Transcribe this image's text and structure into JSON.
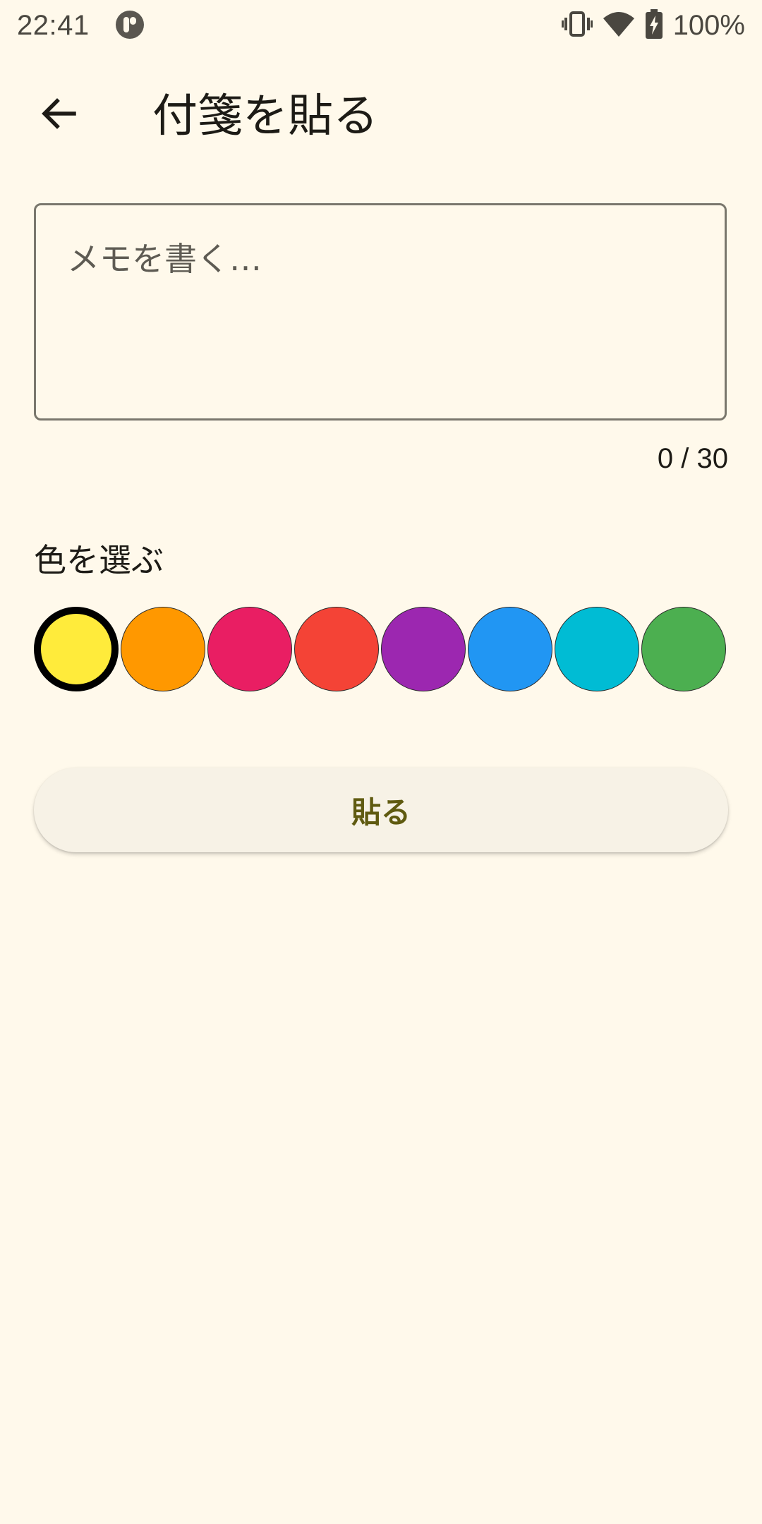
{
  "status_bar": {
    "time": "22:41",
    "app_icon": "pip-app-icon",
    "icons": [
      "vibrate-icon",
      "wifi-icon",
      "battery-charging-icon"
    ],
    "battery": "100%"
  },
  "app_bar": {
    "back_icon": "arrow-left-icon",
    "title": "付箋を貼る"
  },
  "memo": {
    "placeholder": "メモを書く…",
    "value": "",
    "counter": "0 / 30"
  },
  "color_section": {
    "label": "色を選ぶ",
    "selected_index": 0,
    "swatches": [
      "#FFEB3B",
      "#FF9800",
      "#E91E63",
      "#F44336",
      "#9C27B0",
      "#2196F3",
      "#00BCD4",
      "#4CAF50"
    ]
  },
  "submit": {
    "label": "貼る"
  },
  "colors": {
    "background": "#FFF9EB",
    "button_bg": "#F7F2E6",
    "button_text": "#5F5A10",
    "outline": "#7A776D"
  }
}
